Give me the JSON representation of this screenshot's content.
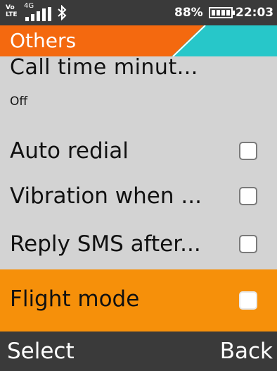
{
  "status_bar": {
    "volte_line1": "Vo",
    "volte_line2": "LTE",
    "network": "4G",
    "battery_percent": "88%",
    "battery_level": 0.88,
    "time": "22:03",
    "icons": [
      "volte-icon",
      "signal-icon",
      "bluetooth-icon",
      "battery-icon"
    ]
  },
  "header": {
    "title": "Others",
    "colors": {
      "title_bg": "#f4690f",
      "accent": "#27c7c9"
    }
  },
  "list": {
    "partial_item_label": "Call time minut...",
    "partial_item_value": "Off",
    "items": [
      {
        "label": "Auto redial",
        "checked": false
      },
      {
        "label": "Vibration when ...",
        "checked": false
      },
      {
        "label": "Reply SMS after...",
        "checked": false
      },
      {
        "label": "Flight mode",
        "checked": false,
        "selected": true
      }
    ],
    "highlight_color": "#f6900a"
  },
  "softkeys": {
    "left": "Select",
    "right": "Back"
  }
}
